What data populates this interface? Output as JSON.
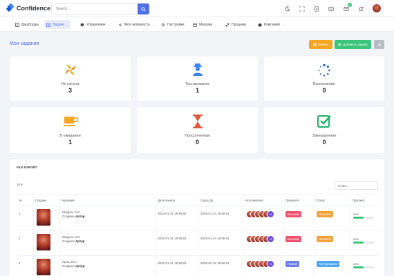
{
  "brand": {
    "name": "Confidence"
  },
  "header": {
    "search_placeholder": "Search...",
    "messages_count": "2"
  },
  "nav": {
    "items": [
      {
        "label": "Дашборды"
      },
      {
        "label": "Задачи"
      },
      {
        "label": "Управление"
      },
      {
        "label": "Моя активность"
      },
      {
        "label": "Настройки"
      },
      {
        "label": "Магазин"
      },
      {
        "label": "Продажи"
      },
      {
        "label": "Компания"
      }
    ]
  },
  "page": {
    "title": "Мои задания",
    "kanban_label": "Канбан",
    "add_task_label": "Добавить задачу"
  },
  "stats": [
    {
      "label": "Не начата",
      "value": "3"
    },
    {
      "label": "Тестирование",
      "value": "1"
    },
    {
      "label": "Выполнение",
      "value": "0"
    },
    {
      "label": "В ожидании",
      "value": "1"
    },
    {
      "label": "Просроченная",
      "value": "0"
    },
    {
      "label": "Завершенная",
      "value": "0"
    }
  ],
  "table": {
    "title": "FILE EXPORT",
    "page_length": "10",
    "filter_placeholder": "Поиск...",
    "columns": [
      "№",
      "Создань",
      "Название",
      "Дата Начала",
      "Сдать До",
      "Исполнители",
      "Приоритет",
      "Статус",
      "Прогресс"
    ],
    "rows": [
      {
        "num": "1",
        "name": "Модуль тест",
        "created_prefix": "Создана",
        "author": "Артур",
        "start": "2022-01-31 19:56:01",
        "due": "2025-01-24 19:56:01",
        "more": "+8",
        "priority": "Высокий",
        "priority_color": "#f0506e",
        "status": "Незанята",
        "status_color": "#f4a13a",
        "progress_text": "50%",
        "progress": 0.5
      },
      {
        "num": "2",
        "name": "Модуль тест",
        "created_prefix": "Создана",
        "author": "Артур",
        "start": "2022-01-31 19:56:01",
        "due": "2025-01-24 19:56:01",
        "more": "+8",
        "priority": "Высокий",
        "priority_color": "#f0506e",
        "status": "Незанята",
        "status_color": "#f4a13a",
        "progress_text": "50%",
        "progress": 0.5
      },
      {
        "num": "4",
        "name": "Прою IGA",
        "created_prefix": "Создана",
        "author": "Артур",
        "start": "2022-01-31 19:56:01",
        "due": "2025-02-10 19:56:01",
        "more": "+8",
        "priority": "Низкий",
        "priority_color": "#6c7ee8",
        "status": "Тестирование",
        "status_color": "#4ba8f0",
        "progress_text": "50%",
        "progress": 0.5
      }
    ]
  },
  "colors": {
    "accent": "#4f6fe6",
    "kanban_btn": "#f5a623",
    "add_btn": "#3cc47c",
    "settings_btn": "#b8bcc6"
  }
}
